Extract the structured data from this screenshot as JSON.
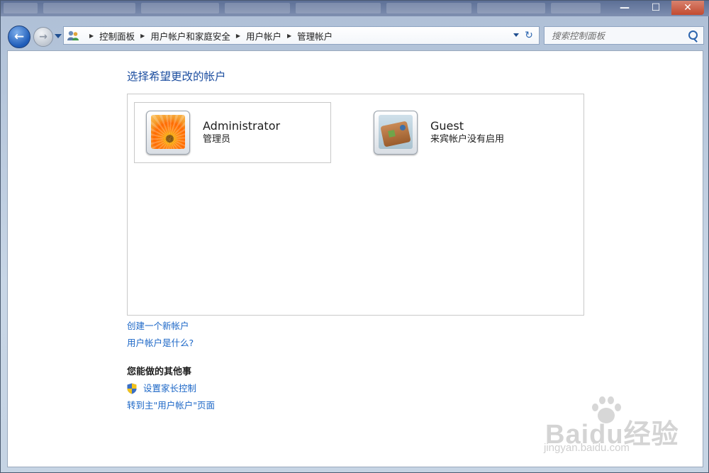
{
  "window": {
    "buttons": {
      "minimize": "—",
      "maximize": "☐",
      "close": "✕"
    }
  },
  "nav": {
    "back_glyph": "←",
    "forward_glyph": "→",
    "breadcrumbs": [
      "控制面板",
      "用户帐户和家庭安全",
      "用户帐户",
      "管理帐户"
    ],
    "separator_glyph": "▶",
    "refresh_glyph": "↻",
    "search_placeholder": "搜索控制面板"
  },
  "main": {
    "heading": "选择希望更改的帐户",
    "accounts": [
      {
        "name": "Administrator",
        "role": "管理员",
        "icon": "flower-avatar",
        "selected": true
      },
      {
        "name": "Guest",
        "role": "来宾帐户没有启用",
        "icon": "suitcase-avatar",
        "selected": false
      }
    ],
    "links": [
      "创建一个新帐户",
      "用户帐户是什么?"
    ],
    "other_title": "您能做的其他事",
    "other_links": [
      {
        "label": "设置家长控制",
        "icon": "uac-shield-icon"
      },
      {
        "label": "转到主\"用户帐户\"页面",
        "icon": null
      }
    ]
  },
  "watermark": {
    "brand": "Bai",
    "brand_cn": "du经验",
    "site": "jingyan.baidu.com"
  },
  "colors": {
    "link": "#1c67c7",
    "heading": "#1e4fa0",
    "frame": "#c8d6e6"
  }
}
